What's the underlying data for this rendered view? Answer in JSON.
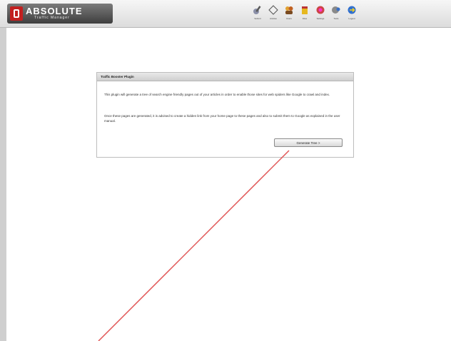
{
  "app": {
    "logo_title": "ABSOLUTE",
    "logo_subtitle": "Traffic Manager"
  },
  "toolbar": {
    "items": [
      {
        "label": "Submit",
        "icon": "pen-icon"
      },
      {
        "label": "Articles",
        "icon": "diamond-icon"
      },
      {
        "label": "Users",
        "icon": "users-icon"
      },
      {
        "label": "Files",
        "icon": "box-icon"
      },
      {
        "label": "Settings",
        "icon": "gear-icon"
      },
      {
        "label": "Tools",
        "icon": "wrench-icon"
      },
      {
        "label": "Logout",
        "icon": "exit-icon"
      }
    ]
  },
  "panel": {
    "title": "Traffic Booster Plugin",
    "paragraph1": "This plugin will generate a tree of search engine friendly pages out of your articles in order to enable those sites for web spiders like Google to crawl and index.",
    "paragraph2": "Once these pages are generated, it is advised to create a hidden link from your home page to these pages and also to submit them to Google as explained in the user manual.",
    "button_label": "Generate Tree >"
  },
  "colors": {
    "annotation_arrow": "#e05555",
    "logo_red": "#c21f1f"
  }
}
